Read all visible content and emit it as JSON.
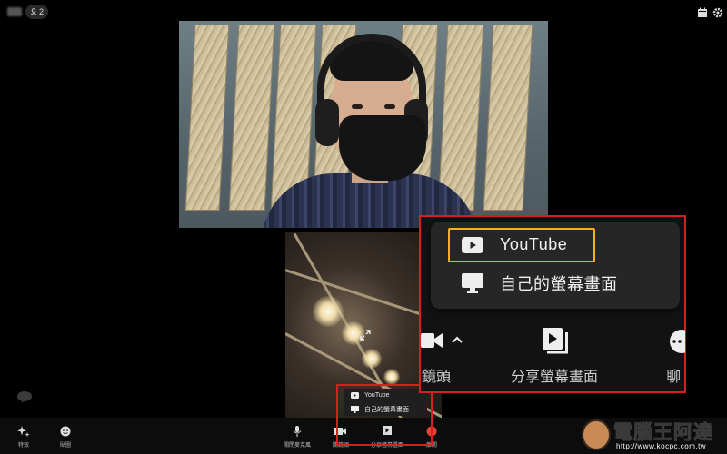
{
  "topbar": {
    "participant_count": "2",
    "icons": [
      "calendar-icon",
      "gear-icon"
    ]
  },
  "main_video": {
    "description_icon": "person-video-icon"
  },
  "second_video": {
    "expand_icon": "expand-icon"
  },
  "toolbar": {
    "items": [
      {
        "label": "特效",
        "icon": "sparkle-icon"
      },
      {
        "label": "貼圖",
        "icon": "emoji-icon"
      },
      {
        "label": "關閉麥克風",
        "icon": "microphone-icon"
      },
      {
        "label": "關鏡頭",
        "icon": "camera-icon"
      },
      {
        "label": "分享螢幕畫面",
        "icon": "share-screen-icon"
      },
      {
        "label": "離開",
        "icon": "leave-icon"
      }
    ]
  },
  "share_menu": {
    "youtube": "YouTube",
    "own_screen": "自己的螢幕畫面"
  },
  "zoom_callout": {
    "youtube": "YouTube",
    "own_screen": "自己的螢幕畫面",
    "camera_label": "鏡頭",
    "share_label": "分享螢幕畫面",
    "chat_label": "聊"
  },
  "watermark": {
    "title": "電腦王阿達",
    "url": "http://www.kocpc.com.tw"
  },
  "colors": {
    "highlight_red": "#d71f1f",
    "highlight_yellow": "#f2b20a",
    "menu_bg": "#262626"
  }
}
